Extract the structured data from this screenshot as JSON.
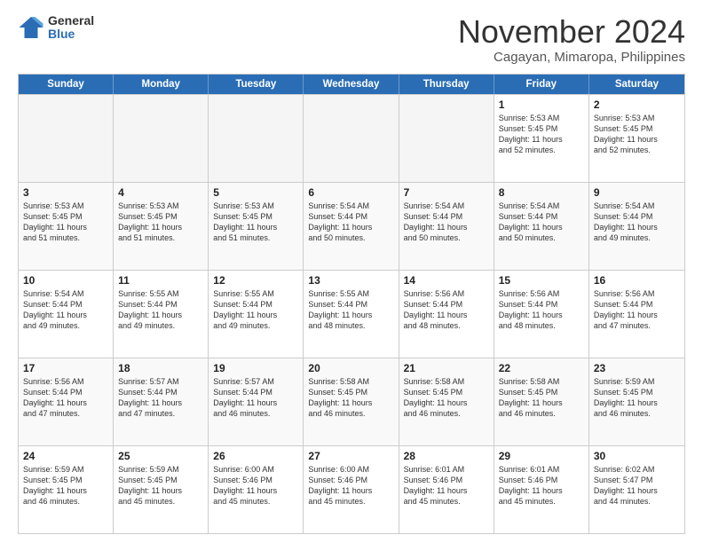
{
  "logo": {
    "general": "General",
    "blue": "Blue"
  },
  "title": "November 2024",
  "subtitle": "Cagayan, Mimaropa, Philippines",
  "header_days": [
    "Sunday",
    "Monday",
    "Tuesday",
    "Wednesday",
    "Thursday",
    "Friday",
    "Saturday"
  ],
  "weeks": [
    [
      {
        "day": "",
        "info": "",
        "empty": true
      },
      {
        "day": "",
        "info": "",
        "empty": true
      },
      {
        "day": "",
        "info": "",
        "empty": true
      },
      {
        "day": "",
        "info": "",
        "empty": true
      },
      {
        "day": "",
        "info": "",
        "empty": true
      },
      {
        "day": "1",
        "info": "Sunrise: 5:53 AM\nSunset: 5:45 PM\nDaylight: 11 hours\nand 52 minutes."
      },
      {
        "day": "2",
        "info": "Sunrise: 5:53 AM\nSunset: 5:45 PM\nDaylight: 11 hours\nand 52 minutes."
      }
    ],
    [
      {
        "day": "3",
        "info": "Sunrise: 5:53 AM\nSunset: 5:45 PM\nDaylight: 11 hours\nand 51 minutes."
      },
      {
        "day": "4",
        "info": "Sunrise: 5:53 AM\nSunset: 5:45 PM\nDaylight: 11 hours\nand 51 minutes."
      },
      {
        "day": "5",
        "info": "Sunrise: 5:53 AM\nSunset: 5:45 PM\nDaylight: 11 hours\nand 51 minutes."
      },
      {
        "day": "6",
        "info": "Sunrise: 5:54 AM\nSunset: 5:44 PM\nDaylight: 11 hours\nand 50 minutes."
      },
      {
        "day": "7",
        "info": "Sunrise: 5:54 AM\nSunset: 5:44 PM\nDaylight: 11 hours\nand 50 minutes."
      },
      {
        "day": "8",
        "info": "Sunrise: 5:54 AM\nSunset: 5:44 PM\nDaylight: 11 hours\nand 50 minutes."
      },
      {
        "day": "9",
        "info": "Sunrise: 5:54 AM\nSunset: 5:44 PM\nDaylight: 11 hours\nand 49 minutes."
      }
    ],
    [
      {
        "day": "10",
        "info": "Sunrise: 5:54 AM\nSunset: 5:44 PM\nDaylight: 11 hours\nand 49 minutes."
      },
      {
        "day": "11",
        "info": "Sunrise: 5:55 AM\nSunset: 5:44 PM\nDaylight: 11 hours\nand 49 minutes."
      },
      {
        "day": "12",
        "info": "Sunrise: 5:55 AM\nSunset: 5:44 PM\nDaylight: 11 hours\nand 49 minutes."
      },
      {
        "day": "13",
        "info": "Sunrise: 5:55 AM\nSunset: 5:44 PM\nDaylight: 11 hours\nand 48 minutes."
      },
      {
        "day": "14",
        "info": "Sunrise: 5:56 AM\nSunset: 5:44 PM\nDaylight: 11 hours\nand 48 minutes."
      },
      {
        "day": "15",
        "info": "Sunrise: 5:56 AM\nSunset: 5:44 PM\nDaylight: 11 hours\nand 48 minutes."
      },
      {
        "day": "16",
        "info": "Sunrise: 5:56 AM\nSunset: 5:44 PM\nDaylight: 11 hours\nand 47 minutes."
      }
    ],
    [
      {
        "day": "17",
        "info": "Sunrise: 5:56 AM\nSunset: 5:44 PM\nDaylight: 11 hours\nand 47 minutes."
      },
      {
        "day": "18",
        "info": "Sunrise: 5:57 AM\nSunset: 5:44 PM\nDaylight: 11 hours\nand 47 minutes."
      },
      {
        "day": "19",
        "info": "Sunrise: 5:57 AM\nSunset: 5:44 PM\nDaylight: 11 hours\nand 46 minutes."
      },
      {
        "day": "20",
        "info": "Sunrise: 5:58 AM\nSunset: 5:45 PM\nDaylight: 11 hours\nand 46 minutes."
      },
      {
        "day": "21",
        "info": "Sunrise: 5:58 AM\nSunset: 5:45 PM\nDaylight: 11 hours\nand 46 minutes."
      },
      {
        "day": "22",
        "info": "Sunrise: 5:58 AM\nSunset: 5:45 PM\nDaylight: 11 hours\nand 46 minutes."
      },
      {
        "day": "23",
        "info": "Sunrise: 5:59 AM\nSunset: 5:45 PM\nDaylight: 11 hours\nand 46 minutes."
      }
    ],
    [
      {
        "day": "24",
        "info": "Sunrise: 5:59 AM\nSunset: 5:45 PM\nDaylight: 11 hours\nand 46 minutes."
      },
      {
        "day": "25",
        "info": "Sunrise: 5:59 AM\nSunset: 5:45 PM\nDaylight: 11 hours\nand 45 minutes."
      },
      {
        "day": "26",
        "info": "Sunrise: 6:00 AM\nSunset: 5:46 PM\nDaylight: 11 hours\nand 45 minutes."
      },
      {
        "day": "27",
        "info": "Sunrise: 6:00 AM\nSunset: 5:46 PM\nDaylight: 11 hours\nand 45 minutes."
      },
      {
        "day": "28",
        "info": "Sunrise: 6:01 AM\nSunset: 5:46 PM\nDaylight: 11 hours\nand 45 minutes."
      },
      {
        "day": "29",
        "info": "Sunrise: 6:01 AM\nSunset: 5:46 PM\nDaylight: 11 hours\nand 45 minutes."
      },
      {
        "day": "30",
        "info": "Sunrise: 6:02 AM\nSunset: 5:47 PM\nDaylight: 11 hours\nand 44 minutes."
      }
    ]
  ]
}
